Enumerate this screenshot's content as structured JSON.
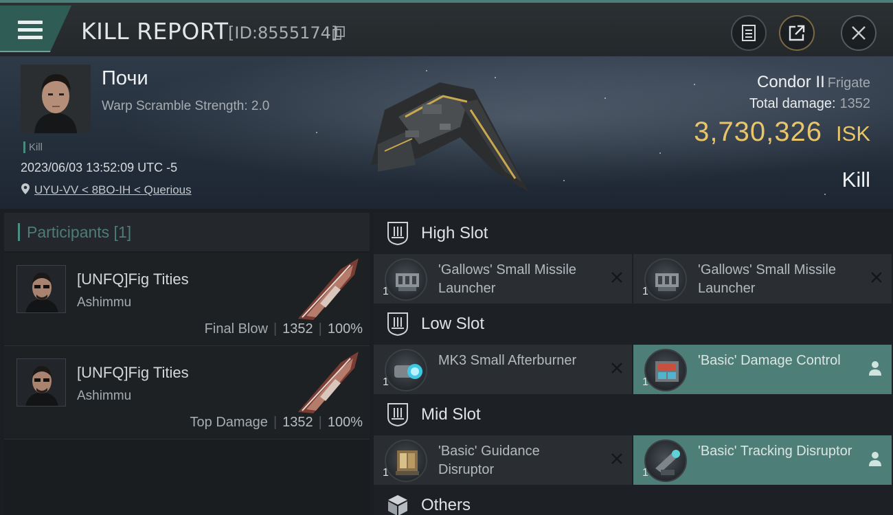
{
  "header": {
    "title": "KILL REPORT",
    "report_id": "[ID:8555174]",
    "icons": {
      "menu": "hamburger-menu-icon",
      "copy": "copy-icon",
      "notes": "notes-icon",
      "share": "share-icon",
      "close": "close-icon"
    }
  },
  "victim": {
    "name": "Почи",
    "warp_scramble": "Warp Scramble Strength: 2.0",
    "kill_tag": "Kill",
    "datetime": "2023/06/03 13:52:09 UTC -5",
    "location": "UYU-VV < 8BO-IH < Querious",
    "ship_name": "Condor II",
    "ship_class": "Frigate",
    "total_damage_label": "Total damage:",
    "total_damage": "1352",
    "isk_value": "3,730,326",
    "isk_unit": "ISK",
    "result": "Kill"
  },
  "participants": {
    "title": "Participants [1]",
    "rows": [
      {
        "name": "[UNFQ]Fig Tities",
        "corp": "Ashimmu",
        "role": "Final Blow",
        "damage": "1352",
        "percent": "100%"
      },
      {
        "name": "[UNFQ]Fig Tities",
        "corp": "Ashimmu",
        "role": "Top Damage",
        "damage": "1352",
        "percent": "100%"
      }
    ]
  },
  "fitting": {
    "high_slot": {
      "title": "High Slot",
      "modules": [
        {
          "qty": "1",
          "name": "'Gallows' Small Missile Launcher",
          "status": "destroyed"
        },
        {
          "qty": "1",
          "name": "'Gallows' Small Missile Launcher",
          "status": "destroyed"
        }
      ]
    },
    "low_slot": {
      "title": "Low Slot",
      "modules": [
        {
          "qty": "1",
          "name": "MK3 Small Afterburner",
          "status": "destroyed"
        },
        {
          "qty": "1",
          "name": "'Basic' Damage Control",
          "status": "dropped"
        }
      ]
    },
    "mid_slot": {
      "title": "Mid Slot",
      "modules": [
        {
          "qty": "1",
          "name": "'Basic' Guidance Disruptor",
          "status": "destroyed"
        },
        {
          "qty": "1",
          "name": "'Basic' Tracking Disruptor",
          "status": "dropped"
        }
      ]
    },
    "others": {
      "title": "Others"
    }
  },
  "colors": {
    "accent_teal": "#4e7e78",
    "isk_gold": "#e8c56a",
    "panel_dark": "#1d2024"
  }
}
